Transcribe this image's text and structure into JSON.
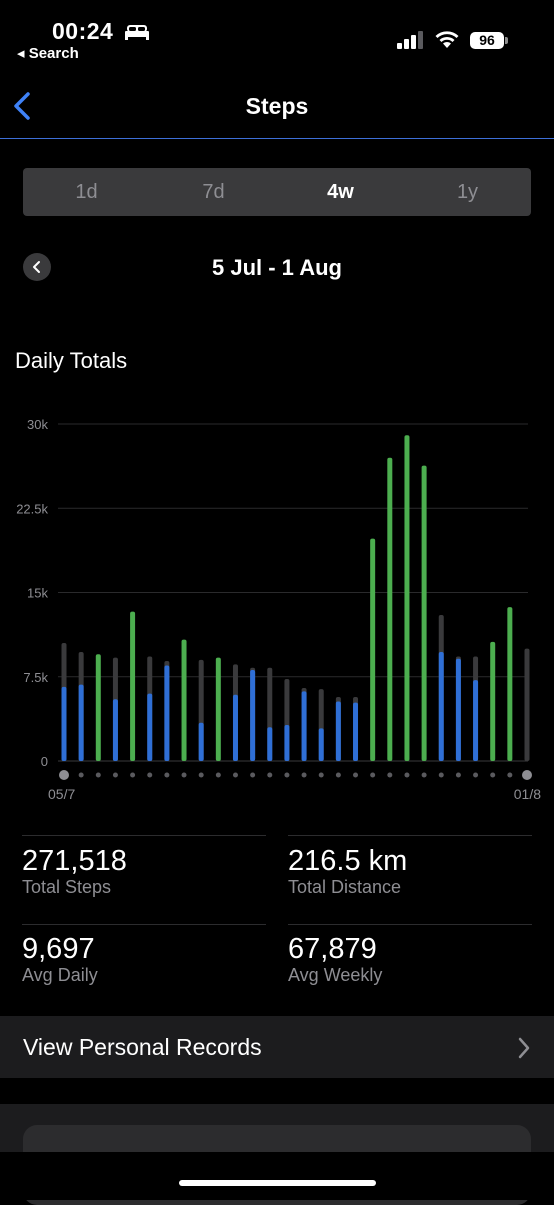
{
  "status": {
    "time": "00:24",
    "back_label": "◂ Search",
    "battery": "96"
  },
  "nav": {
    "title": "Steps"
  },
  "range_tabs": [
    "1d",
    "7d",
    "4w",
    "1y"
  ],
  "selected_range": "4w",
  "date_range": "5 Jul - 1 Aug",
  "section_title": "Daily Totals",
  "chart_data": {
    "type": "bar",
    "ylim": [
      0,
      30000
    ],
    "y_ticks": [
      0,
      7500,
      15000,
      22500,
      30000
    ],
    "y_tick_labels": [
      "0",
      "7.5k",
      "15k",
      "22.5k",
      "30k"
    ],
    "x_start_label": "05/7",
    "x_end_label": "01/8",
    "grid": true,
    "series": [
      {
        "values": [
          10500,
          9700,
          0,
          9200,
          0,
          9300,
          8900,
          0,
          9000,
          0,
          8600,
          8300,
          8300,
          7300,
          6500,
          6400,
          5700,
          5700,
          0,
          0,
          0,
          0,
          13000,
          9300,
          9300,
          0,
          0,
          10000
        ]
      },
      {
        "values": [
          6600,
          6800,
          9500,
          5500,
          13300,
          6000,
          8500,
          10800,
          3400,
          9200,
          5900,
          8100,
          3000,
          3200,
          6200,
          2900,
          5300,
          5200,
          19800,
          27000,
          29000,
          26300,
          9700,
          9100,
          7200,
          10600,
          13700,
          0
        ]
      }
    ],
    "colors": {
      "goal_met": "#4cae4f",
      "below_goal": "#2f6fd6",
      "target": "#3a3a3c"
    }
  },
  "stats": [
    {
      "value": "271,518",
      "label": "Total Steps"
    },
    {
      "value": "216.5 km",
      "label": "Total Distance"
    },
    {
      "value": "9,697",
      "label": "Avg Daily"
    },
    {
      "value": "67,879",
      "label": "Avg Weekly"
    }
  ],
  "records_label": "View Personal Records"
}
